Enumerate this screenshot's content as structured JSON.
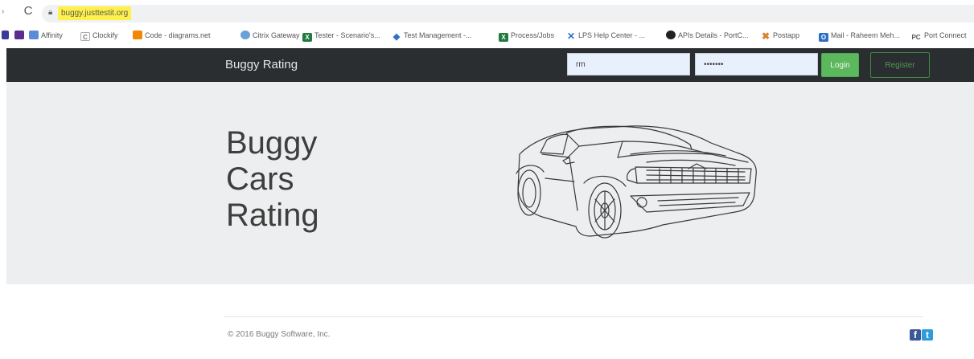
{
  "browser": {
    "url": "buggy.justtestit.org",
    "bookmarks": [
      {
        "label": "Affinity",
        "icon": "affinity-icon",
        "color": "#5b8dd6"
      },
      {
        "label": "Clockify",
        "icon": "clockify-icon",
        "color": "#888888"
      },
      {
        "label": "Code - diagrams.net",
        "icon": "diagrams-icon",
        "color": "#f08705"
      },
      {
        "label": "Citrix Gateway",
        "icon": "citrix-icon",
        "color": "#6aa0d8"
      },
      {
        "label": "Tester - Scenario's...",
        "icon": "excel-icon",
        "color": "#1f7a3e"
      },
      {
        "label": "Test Management -...",
        "icon": "diamond-icon",
        "color": "#2d74c4"
      },
      {
        "label": "Process/Jobs",
        "icon": "excel-icon",
        "color": "#1f7a3e"
      },
      {
        "label": "LPS Help Center - ...",
        "icon": "confluence-icon",
        "color": "#2a6fd6"
      },
      {
        "label": "APIs Details - PortC...",
        "icon": "github-icon",
        "color": "#222222"
      },
      {
        "label": "Postapp",
        "icon": "postapp-icon",
        "color": "#d9822b"
      },
      {
        "label": "Mail - Raheem Meh...",
        "icon": "outlook-icon",
        "color": "#2c6fc4"
      },
      {
        "label": "Port Connect",
        "icon": "portconnect-icon",
        "color": "#555555"
      }
    ]
  },
  "navbar": {
    "brand": "Buggy Rating",
    "username_value": "rm",
    "password_value": "•••••••",
    "login_label": "Login",
    "register_label": "Register"
  },
  "hero": {
    "title_lines": [
      "Buggy",
      "Cars",
      "Rating"
    ]
  },
  "footer": {
    "copyright": "© 2016 Buggy Software, Inc.",
    "social": [
      {
        "icon": "facebook-icon",
        "glyph": "f",
        "color": "#3b5998"
      },
      {
        "icon": "twitter-icon",
        "glyph": "t",
        "color": "#2f9bd8"
      }
    ]
  },
  "colors": {
    "navbar_bg": "#2b2e31",
    "hero_bg": "#eceeef",
    "login_green": "#5cb85c",
    "url_highlight": "#fff14a"
  }
}
